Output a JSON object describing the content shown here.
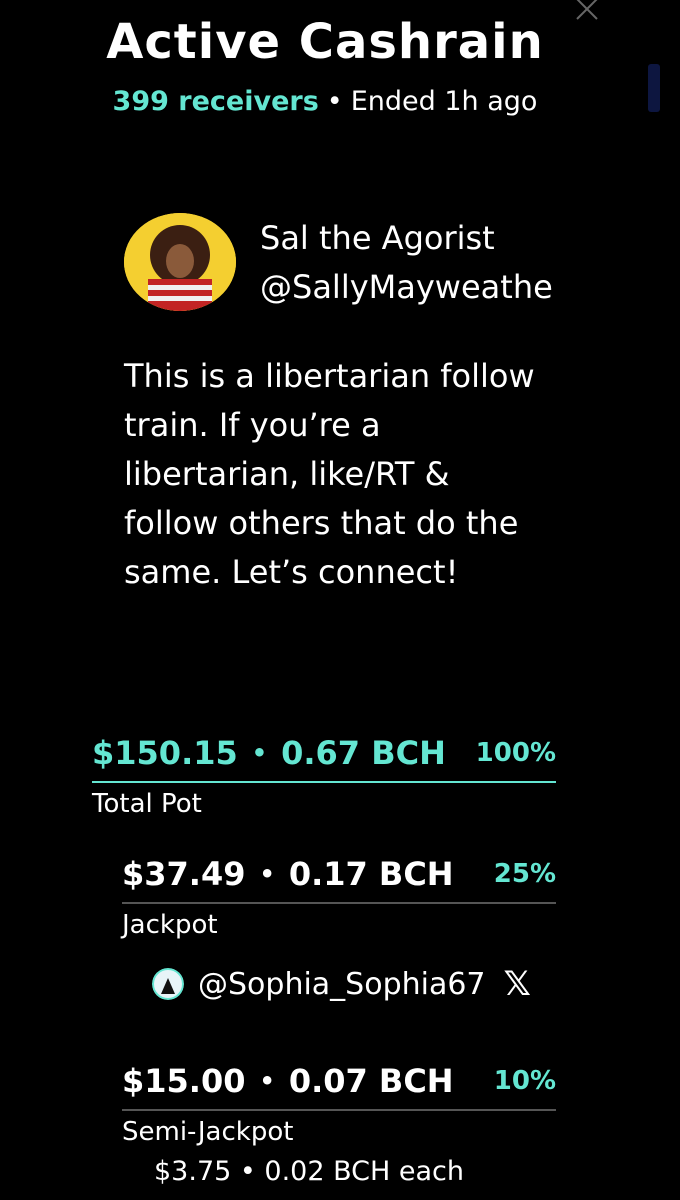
{
  "header": {
    "title": "Active Cashrain",
    "receivers": "399 receivers",
    "separator": "•",
    "status": "Ended 1h ago"
  },
  "author": {
    "name": "Sal the Agorist",
    "handle": "@SallyMayweathe"
  },
  "message": "This is a libertarian follow train. If you’re a libertarian, like/RT & follow others that do the same. Let’s connect!",
  "pots": {
    "total": {
      "usd": "$150.15",
      "bch": "0.67 BCH",
      "percent": "100%",
      "label": "Total Pot"
    },
    "jackpot": {
      "usd": "$37.49",
      "bch": "0.17 BCH",
      "percent": "25%",
      "label": "Jackpot"
    },
    "semi_jackpot": {
      "usd": "$15.00",
      "bch": "0.07 BCH",
      "percent": "10%",
      "label": "Semi-Jackpot",
      "each": "$3.75 • 0.02 BCH each"
    }
  },
  "jackpot_winner": {
    "handle": "@Sophia_Sophia67",
    "platform_icon": "x-logo-icon"
  },
  "icons": {
    "close": "close-icon",
    "avatar": "avatar"
  },
  "colors": {
    "accent": "#64e6d2",
    "background": "#000000",
    "text": "#ffffff"
  }
}
